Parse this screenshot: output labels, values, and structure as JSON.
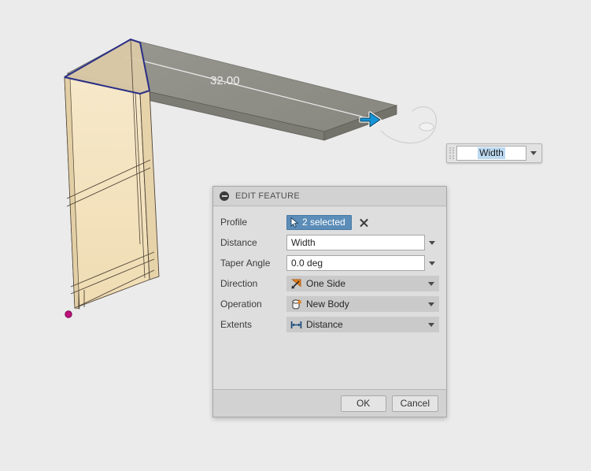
{
  "viewport": {
    "background_color": "#ebebeb",
    "dimension_label": "32.00",
    "solid_body_color": "#f2e0bd",
    "preview_body_color": "#8a8a82",
    "highlight_edge_color": "#2b2f86",
    "origin_point_color": "#c0107c",
    "manipulator_arrow_color": "#1595d8"
  },
  "float_input": {
    "value": "Width",
    "grip_icon": "drag-grip-icon",
    "dropdown_icon": "chevron-down-icon"
  },
  "dialog": {
    "title": "EDIT FEATURE",
    "collapse_icon": "collapse-minus-icon",
    "rows": {
      "profile": {
        "label": "Profile",
        "chip_text": "2 selected",
        "chip_icon": "cursor-select-icon",
        "clear_icon": "close-x-icon"
      },
      "distance": {
        "label": "Distance",
        "value": "Width",
        "dropdown_icon": "chevron-down-icon"
      },
      "taper_angle": {
        "label": "Taper Angle",
        "value": "0.0 deg",
        "dropdown_icon": "chevron-down-icon"
      },
      "direction": {
        "label": "Direction",
        "value": "One Side",
        "icon": "direction-one-side-icon",
        "dropdown_icon": "chevron-down-icon"
      },
      "operation": {
        "label": "Operation",
        "value": "New Body",
        "icon": "new-body-icon",
        "dropdown_icon": "chevron-down-icon"
      },
      "extents": {
        "label": "Extents",
        "value": "Distance",
        "icon": "extents-distance-icon",
        "dropdown_icon": "chevron-down-icon"
      }
    },
    "footer": {
      "ok_label": "OK",
      "cancel_label": "Cancel"
    }
  }
}
